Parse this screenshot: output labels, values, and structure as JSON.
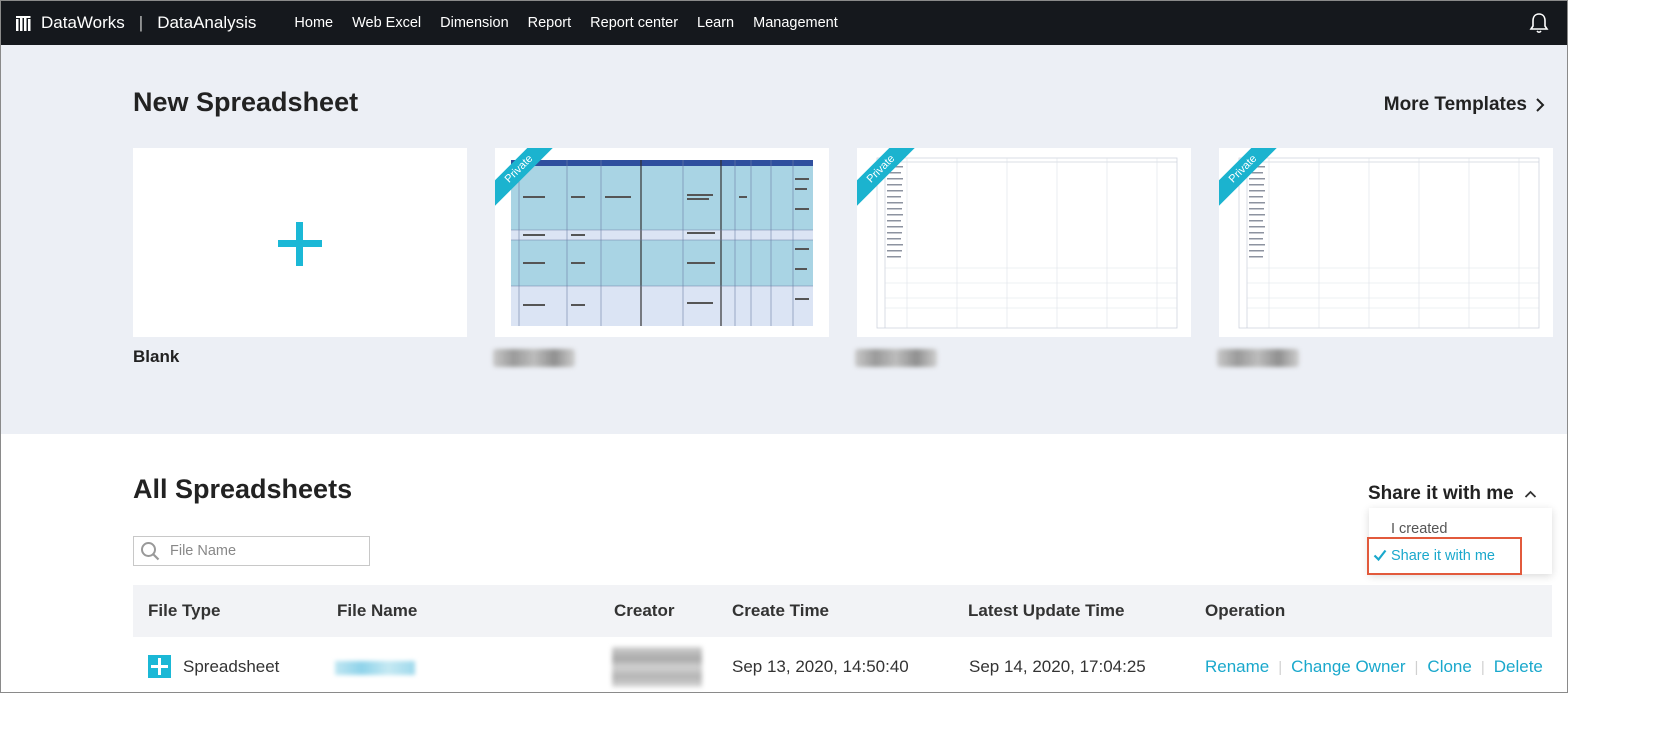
{
  "nav": {
    "brand": "DataWorks",
    "product": "DataAnalysis",
    "items": [
      "Home",
      "Web Excel",
      "Dimension",
      "Report",
      "Report center",
      "Learn",
      "Management"
    ]
  },
  "templates": {
    "title": "New Spreadsheet",
    "more_label": "More Templates",
    "blank_label": "Blank",
    "private_tag": "Private"
  },
  "spreadsheets": {
    "title": "All Spreadsheets",
    "filter_label": "Share it with me",
    "filter_options": [
      "I created",
      "Share it with me"
    ],
    "search_placeholder": "File Name",
    "columns": [
      "File Type",
      "File Name",
      "Creator",
      "Create Time",
      "Latest Update Time",
      "Operation"
    ],
    "rows": [
      {
        "file_type": "Spreadsheet",
        "create_time": "Sep 13, 2020, 14:50:40",
        "update_time": "Sep 14, 2020, 17:04:25"
      }
    ],
    "operations": [
      "Rename",
      "Change Owner",
      "Clone",
      "Delete"
    ]
  },
  "colors": {
    "nav_bg": "#15181d",
    "accent": "#1aa8cc",
    "highlight": "#e25a3c",
    "section_bg": "#eceff5"
  }
}
